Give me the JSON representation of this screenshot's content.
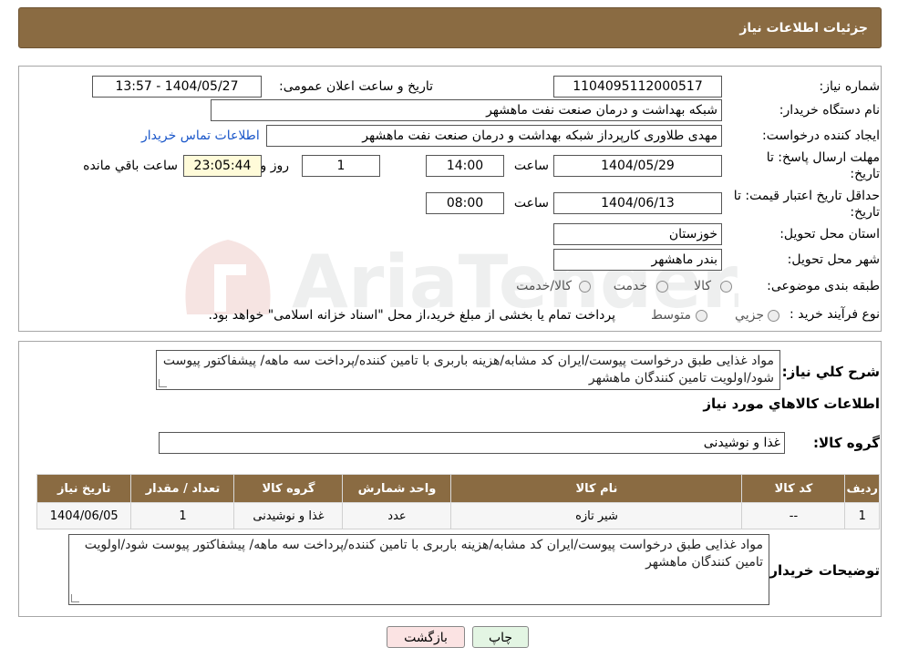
{
  "header": {
    "title": "جزئیات اطلاعات نیاز"
  },
  "fields": {
    "need_number_label": "شماره نیاز:",
    "need_number": "1104095112000517",
    "announce_label": "تاریخ و ساعت اعلان عمومی:",
    "announce_value": "1404/05/27 - 13:57",
    "buyer_org_label": "نام دستگاه خریدار:",
    "buyer_org": "شبکه بهداشت و درمان صنعت نفت ماهشهر",
    "creator_label": "ایجاد کننده درخواست:",
    "creator": "مهدی طلاوری کارپرداز شبکه بهداشت و درمان صنعت نفت ماهشهر",
    "contact_link": "اطلاعات تماس خریدار",
    "deadline_label_1": "مهلت ارسال پاسخ: تا",
    "deadline_label_2": "تاریخ:",
    "deadline_date": "1404/05/29",
    "time_label": "ساعت",
    "deadline_time": "14:00",
    "days_value": "1",
    "days_label": "روز و",
    "remaining_time": "23:05:44",
    "remaining_label": "ساعت باقي مانده",
    "validity_label_1": "حداقل تاریخ اعتبار قیمت: تا",
    "validity_label_2": "تاریخ:",
    "validity_date": "1404/06/13",
    "validity_time": "08:00",
    "province_label": "استان محل تحویل:",
    "province": "خوزستان",
    "city_label": "شهر محل تحویل:",
    "city": "بندر ماهشهر",
    "category_label": "طبقه بندی موضوعی:",
    "category_options": [
      "کالا",
      "خدمت",
      "کالا/خدمت"
    ],
    "process_label": "نوع فرآیند خرید :",
    "process_options": [
      "جزیي",
      "متوسط"
    ],
    "process_note": "پرداخت تمام یا بخشی از مبلغ خرید،از محل \"اسناد خزانه اسلامی\" خواهد بود."
  },
  "description": {
    "label": "شرح کلي نياز:",
    "text": "مواد غذایی طبق درخواست پیوست/ایران کد مشابه/هزینه باربری با تامین کننده/پرداخت سه ماهه/ پیشفاکتور پیوست شود/اولویت تامین کنندگان ماهشهر"
  },
  "goods": {
    "section_title": "اطلاعات کالاهاي مورد نياز",
    "group_label": "گروه کالا:",
    "group_value": "غذا و نوشیدنی",
    "columns": [
      "ردیف",
      "کد کالا",
      "نام کالا",
      "واحد شمارش",
      "گروه کالا",
      "تعداد / مقدار",
      "تاریخ نیاز"
    ],
    "rows": [
      {
        "row": "1",
        "code": "--",
        "name": "شیر تازه",
        "unit": "عدد",
        "group": "غذا و نوشیدنی",
        "qty": "1",
        "date": "1404/06/05"
      }
    ]
  },
  "buyer_notes": {
    "label": "توضیحات خریدار:",
    "text": "مواد غذایی طبق درخواست پیوست/ایران کد مشابه/هزینه باربری با تامین کننده/پرداخت سه ماهه/ پیشفاکتور پیوست شود/اولویت تامین کنندگان ماهشهر"
  },
  "buttons": {
    "print": "چاپ",
    "back": "بازگشت"
  },
  "watermark": {
    "text": "AriaTender.neT"
  },
  "colors": {
    "header": "#8a6b42",
    "time_box": "#fffbd9",
    "back_button": "#fbe3e3",
    "print_button": "#e3f5e3",
    "link": "#1a56c9"
  }
}
